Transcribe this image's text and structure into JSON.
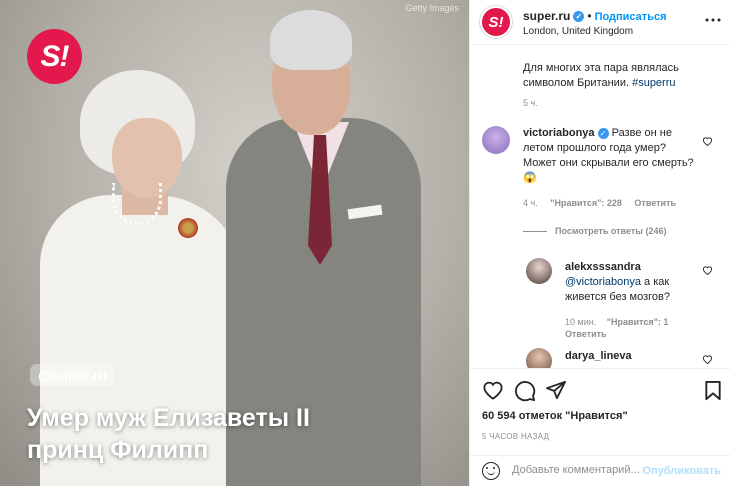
{
  "photo": {
    "credit": "Getty Images",
    "brand_logo": "S!",
    "handle": "@super.ru",
    "headline_line1": "Умер муж Елизаветы II",
    "headline_line2": "принц Филипп"
  },
  "header": {
    "avatar_text": "S!",
    "username": "super.ru",
    "separator": "•",
    "follow_label": "Подписаться",
    "location": "London, United Kingdom",
    "more_icon": "more-icon"
  },
  "caption": {
    "line1": "Для многих эта пара являлась",
    "line2": "символом Британии.",
    "hashtag": "#superru",
    "time": "5 ч."
  },
  "comments": [
    {
      "username": "victoriabonya",
      "text": "Разве он не летом прошлого года умер? Может они скрывали его смерть? 😱",
      "time": "4 ч.",
      "likes": "\"Нравится\": 228",
      "reply_label": "Ответить",
      "view_replies": "Посмотреть ответы (246)"
    }
  ],
  "replies": [
    {
      "username": "alekxsssandra",
      "mention": "@victoriabonya",
      "text": " а как живется без мозгов?",
      "time": "10 мин.",
      "likes": "\"Нравится\": 1",
      "reply_label": "Ответить"
    },
    {
      "username": "darya_lineva"
    }
  ],
  "actions": {
    "likes_text": "60 594 отметок \"Нравится\"",
    "post_time": "5 ЧАСОВ НАЗАД",
    "comment_placeholder": "Добавьте комментарий...",
    "publish_label": "Опубликовать"
  },
  "colors": {
    "brand": "#e3194e",
    "link": "#0095f6",
    "verified": "#3897f0"
  }
}
